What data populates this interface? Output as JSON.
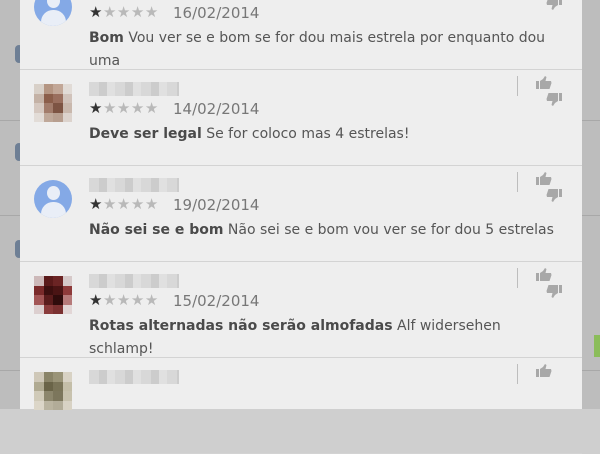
{
  "reviews": [
    {
      "date": "16/02/2014",
      "title": "Bom",
      "body": "Vou ver se e bom se for dou mais estrela por enquanto dou uma",
      "stars": 1,
      "avatar": "default"
    },
    {
      "date": "14/02/2014",
      "title": "Deve ser legal",
      "body": "Se for coloco mas 4 estrelas!",
      "stars": 1,
      "avatar": "pixelated-tan"
    },
    {
      "date": "19/02/2014",
      "title": "Não sei se e bom",
      "body": "Não sei se e bom vou ver se for dou 5 estrelas",
      "stars": 1,
      "avatar": "default"
    },
    {
      "date": "15/02/2014",
      "title": "Rotas alternadas não serão almofadas",
      "body": "Alf widersehen schlamp!",
      "stars": 1,
      "avatar": "pixelated-red"
    }
  ],
  "icons": {
    "review_action": "thumbs-up-down-icon",
    "rating": "star-icon"
  },
  "colors": {
    "panel_bg": "#eeeeee",
    "avatar_default": "#84a9e6",
    "star_filled": "#333333",
    "star_empty": "#b9b9b9"
  }
}
